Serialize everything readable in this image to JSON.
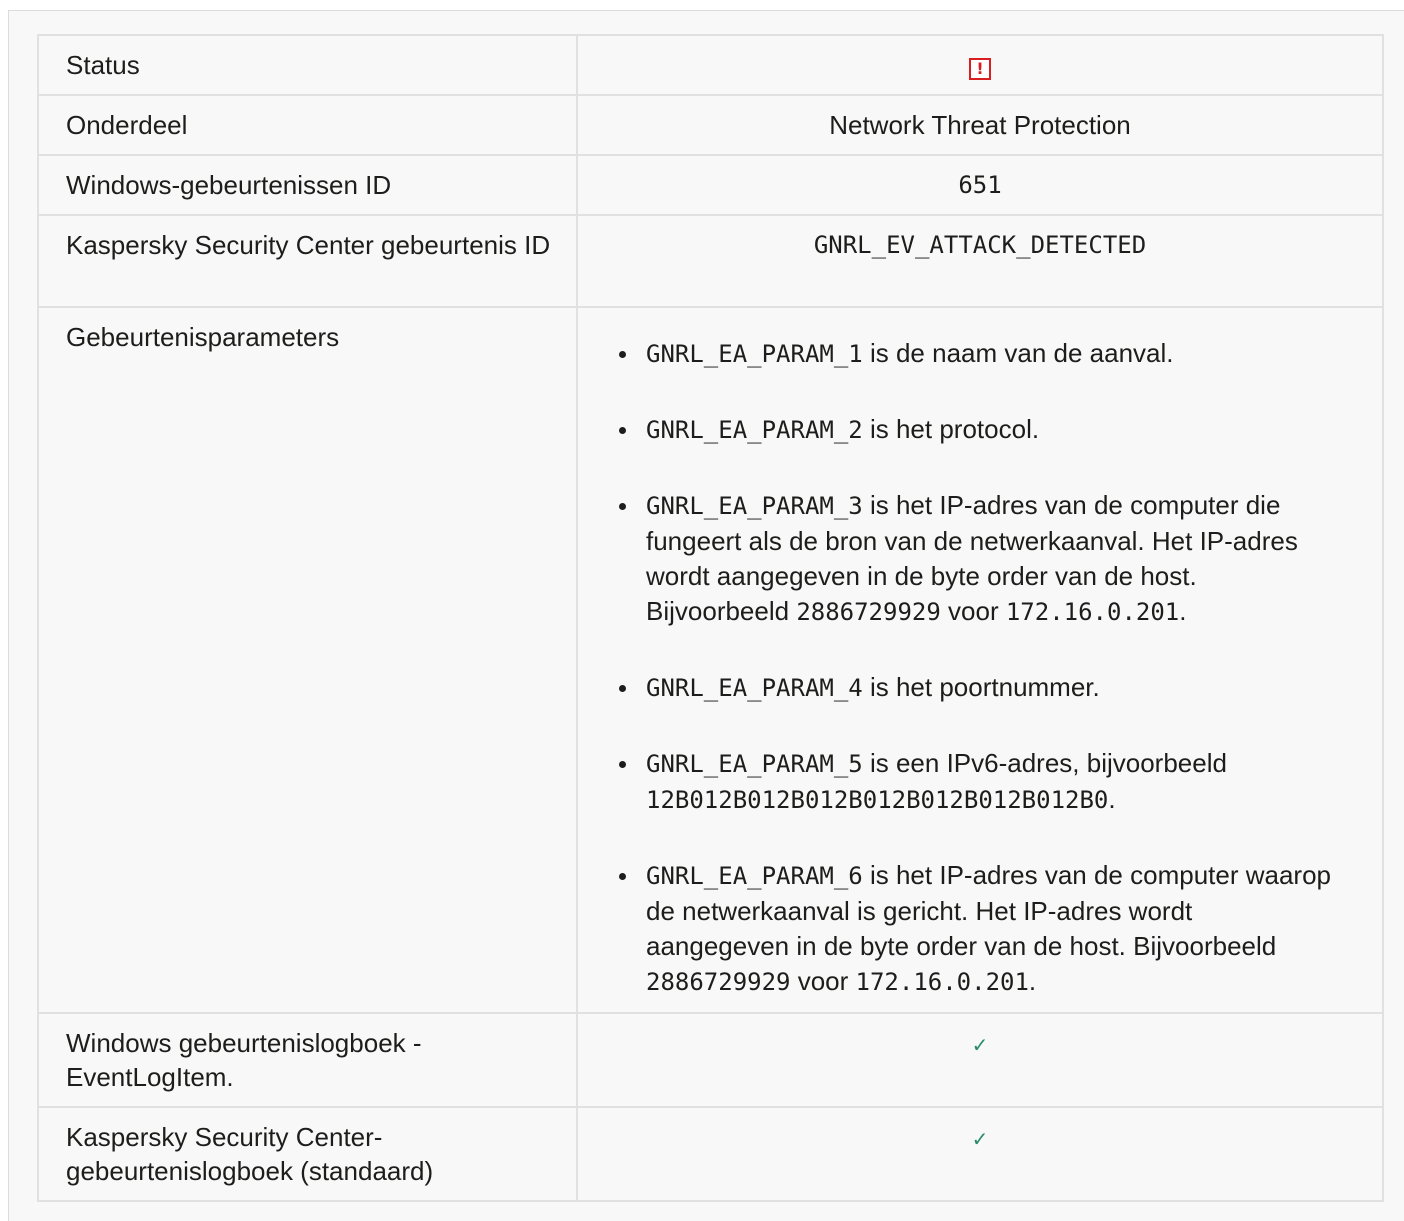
{
  "rows": {
    "status": {
      "label": "Status",
      "icon": "warning-icon",
      "icon_glyph": "!",
      "icon_color": "#d81e1e"
    },
    "component": {
      "label": "Onderdeel",
      "value": "Network Threat Protection"
    },
    "windows_event_id": {
      "label": "Windows-gebeurtenissen ID",
      "value": "651"
    },
    "ksc_event_id": {
      "label": "Kaspersky Security Center gebeurtenis ID",
      "value": "GNRL_EV_ATTACK_DETECTED"
    },
    "event_parameters": {
      "label": "Gebeurtenisparameters",
      "items": [
        {
          "code": "GNRL_EA_PARAM_1",
          "text": " is de naam van de aanval."
        },
        {
          "code": "GNRL_EA_PARAM_2",
          "text": " is het protocol."
        },
        {
          "code": "GNRL_EA_PARAM_3",
          "text": " is het IP-adres van de computer die fungeert als de bron van de netwerkaanval. Het IP-adres wordt aangegeven in de byte order van de host. Bijvoorbeeld ",
          "ex_num": "2886729929",
          "mid": " voor ",
          "ex_ip": "172.16.0.201",
          "end": "."
        },
        {
          "code": "GNRL_EA_PARAM_4",
          "text": " is het poortnummer."
        },
        {
          "code": "GNRL_EA_PARAM_5",
          "text": " is een IPv6-adres, bijvoorbeeld ",
          "ex_num": "12B012B012B012B012B012B012B012B0",
          "end": "."
        },
        {
          "code": "GNRL_EA_PARAM_6",
          "text": " is het IP-adres van de computer waarop de netwerkaanval is gericht. Het IP-adres wordt aangegeven in de byte order van de host. Bijvoorbeeld ",
          "ex_num": "2886729929",
          "mid": " voor ",
          "ex_ip": "172.16.0.201",
          "end": "."
        }
      ]
    },
    "windows_log": {
      "label": "Windows gebeurtenislogboek - EventLogItem.",
      "icon": "check-icon",
      "icon_glyph": "✓",
      "icon_color": "#2a8b6a"
    },
    "ksc_log": {
      "label": "Kaspersky Security Center-gebeurtenislogboek (standaard)",
      "icon": "check-icon",
      "icon_glyph": "✓",
      "icon_color": "#2a8b6a"
    }
  }
}
